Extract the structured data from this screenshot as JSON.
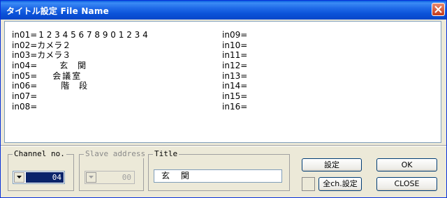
{
  "window": {
    "title": "タイトル設定 File Name"
  },
  "inputs_left": [
    {
      "label": "in01=",
      "value": "1 2 3 4 5 6 7 8 9 0 1 2 3 4"
    },
    {
      "label": "in02=",
      "value": "カメラ２"
    },
    {
      "label": "in03=",
      "value": "カメラ３"
    },
    {
      "label": "in04=",
      "value": "玄 関"
    },
    {
      "label": "in05=",
      "value": "会議室"
    },
    {
      "label": "in06=",
      "value": "階 段"
    },
    {
      "label": "in07=",
      "value": ""
    },
    {
      "label": "in08=",
      "value": ""
    }
  ],
  "inputs_right": [
    {
      "label": "in09=",
      "value": ""
    },
    {
      "label": "in10=",
      "value": ""
    },
    {
      "label": "in11=",
      "value": ""
    },
    {
      "label": "in12=",
      "value": ""
    },
    {
      "label": "in13=",
      "value": ""
    },
    {
      "label": "in14=",
      "value": ""
    },
    {
      "label": "in15=",
      "value": ""
    },
    {
      "label": "in16=",
      "value": ""
    }
  ],
  "channel": {
    "legend": "Channel no.",
    "value": "04"
  },
  "slave": {
    "legend": "Slave address",
    "value": "00"
  },
  "title_group": {
    "legend": "Title",
    "value": "玄 関"
  },
  "buttons": {
    "settei": "設定",
    "ok": "OK",
    "all_ch": "全ch.設定",
    "close": "CLOSE"
  },
  "colors": {
    "titlebar": "#0a52d8",
    "selection": "#0a246a",
    "face": "#ece9d8"
  }
}
